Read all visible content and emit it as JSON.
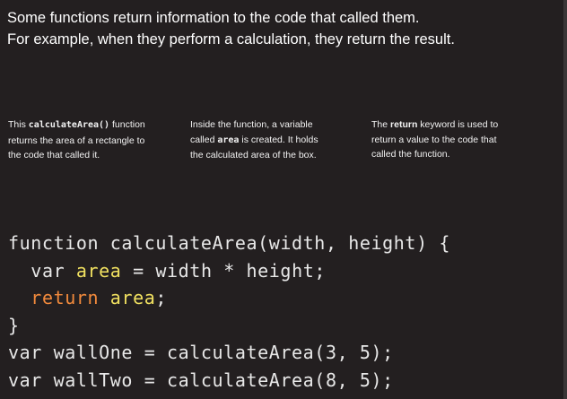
{
  "intro": {
    "line1": "Some functions return information to the code that called them.",
    "line2": "For example, when they perform a calculation, they return the result."
  },
  "notes": [
    {
      "pre": "This ",
      "code": "calculateArea()",
      "post": " function\nreturns the area of a rectangle to\nthe code that called it."
    },
    {
      "pre": "Inside the function, a variable\ncalled ",
      "code": "area",
      "post": " is created. It holds\nthe calculated area of the box."
    },
    {
      "pre": "The ",
      "code": "return",
      "post": " keyword is used to\nreturn a value to the code that\ncalled the function."
    }
  ],
  "code": {
    "l1": "function calculateArea(width, height) {",
    "l2_indent": "  ",
    "l2_var": "var ",
    "l2_name": "area",
    "l2_rest": " = width * height;",
    "l3_indent": "  ",
    "l3_kw": "return ",
    "l3_name": "area",
    "l3_rest": ";",
    "l4": "}",
    "l5": "var wallOne = calculateArea(3, 5);",
    "l6": "var wallTwo = calculateArea(8, 5);"
  },
  "colors": {
    "background": "#231f20",
    "keyword_orange": "#f28a3c",
    "variable_yellow": "#f0e060",
    "text": "#ffffff"
  }
}
